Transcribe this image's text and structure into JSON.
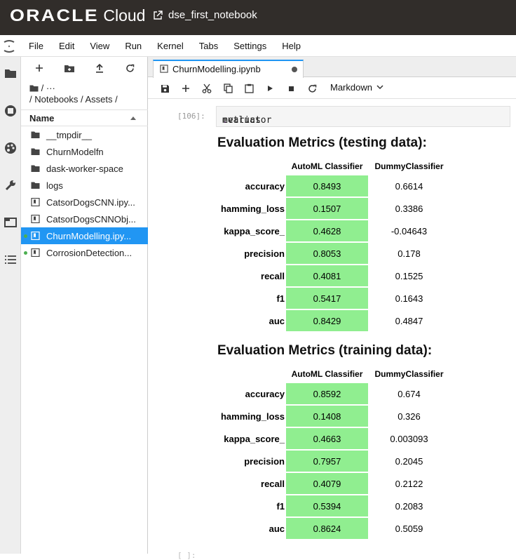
{
  "header": {
    "logo_oracle": "ORACLE",
    "logo_cloud": "Cloud",
    "notebook_title": "dse_first_notebook"
  },
  "menu": [
    "File",
    "Edit",
    "View",
    "Run",
    "Kernel",
    "Tabs",
    "Settings",
    "Help"
  ],
  "filebrowser": {
    "breadcrumb_top": "/ ···",
    "breadcrumb_path": "/ Notebooks / Assets /",
    "column_name": "Name",
    "items": [
      {
        "label": "__tmpdir__",
        "type": "folder"
      },
      {
        "label": "ChurnModelfn",
        "type": "folder"
      },
      {
        "label": "dask-worker-space",
        "type": "folder"
      },
      {
        "label": "logs",
        "type": "folder"
      },
      {
        "label": "CatsorDogsCNN.ipy...",
        "type": "notebook"
      },
      {
        "label": "CatsorDogsCNNObj...",
        "type": "notebook"
      },
      {
        "label": "ChurnModelling.ipy...",
        "type": "notebook",
        "selected": true,
        "running": true
      },
      {
        "label": "CorrosionDetection...",
        "type": "notebook",
        "running": true
      }
    ]
  },
  "tab": {
    "label": "ChurnModelling.ipynb"
  },
  "toolbar": {
    "cell_type": "Markdown"
  },
  "cell": {
    "prompt": "[106]:",
    "code_obj": "evaluator",
    "code_dot": ".",
    "code_attr": "metrics",
    "next_prompt": "[ ]:"
  },
  "testing": {
    "title": "Evaluation Metrics (testing data):",
    "col_auto": "AutoML Classifier",
    "col_dummy": "DummyClassifier",
    "rows": [
      {
        "metric": "accuracy",
        "auto": "0.8493",
        "dummy": "0.6614"
      },
      {
        "metric": "hamming_loss",
        "auto": "0.1507",
        "dummy": "0.3386"
      },
      {
        "metric": "kappa_score_",
        "auto": "0.4628",
        "dummy": "-0.04643"
      },
      {
        "metric": "precision",
        "auto": "0.8053",
        "dummy": "0.178"
      },
      {
        "metric": "recall",
        "auto": "0.4081",
        "dummy": "0.1525"
      },
      {
        "metric": "f1",
        "auto": "0.5417",
        "dummy": "0.1643"
      },
      {
        "metric": "auc",
        "auto": "0.8429",
        "dummy": "0.4847"
      }
    ]
  },
  "training": {
    "title": "Evaluation Metrics (training data):",
    "col_auto": "AutoML Classifier",
    "col_dummy": "DummyClassifier",
    "rows": [
      {
        "metric": "accuracy",
        "auto": "0.8592",
        "dummy": "0.674"
      },
      {
        "metric": "hamming_loss",
        "auto": "0.1408",
        "dummy": "0.326"
      },
      {
        "metric": "kappa_score_",
        "auto": "0.4663",
        "dummy": "0.003093"
      },
      {
        "metric": "precision",
        "auto": "0.7957",
        "dummy": "0.2045"
      },
      {
        "metric": "recall",
        "auto": "0.4079",
        "dummy": "0.2122"
      },
      {
        "metric": "f1",
        "auto": "0.5394",
        "dummy": "0.2083"
      },
      {
        "metric": "auc",
        "auto": "0.8624",
        "dummy": "0.5059"
      }
    ]
  },
  "colors": {
    "header_bg": "#312d2a",
    "accent": "#2196f3",
    "highlight": "#90ee90"
  }
}
